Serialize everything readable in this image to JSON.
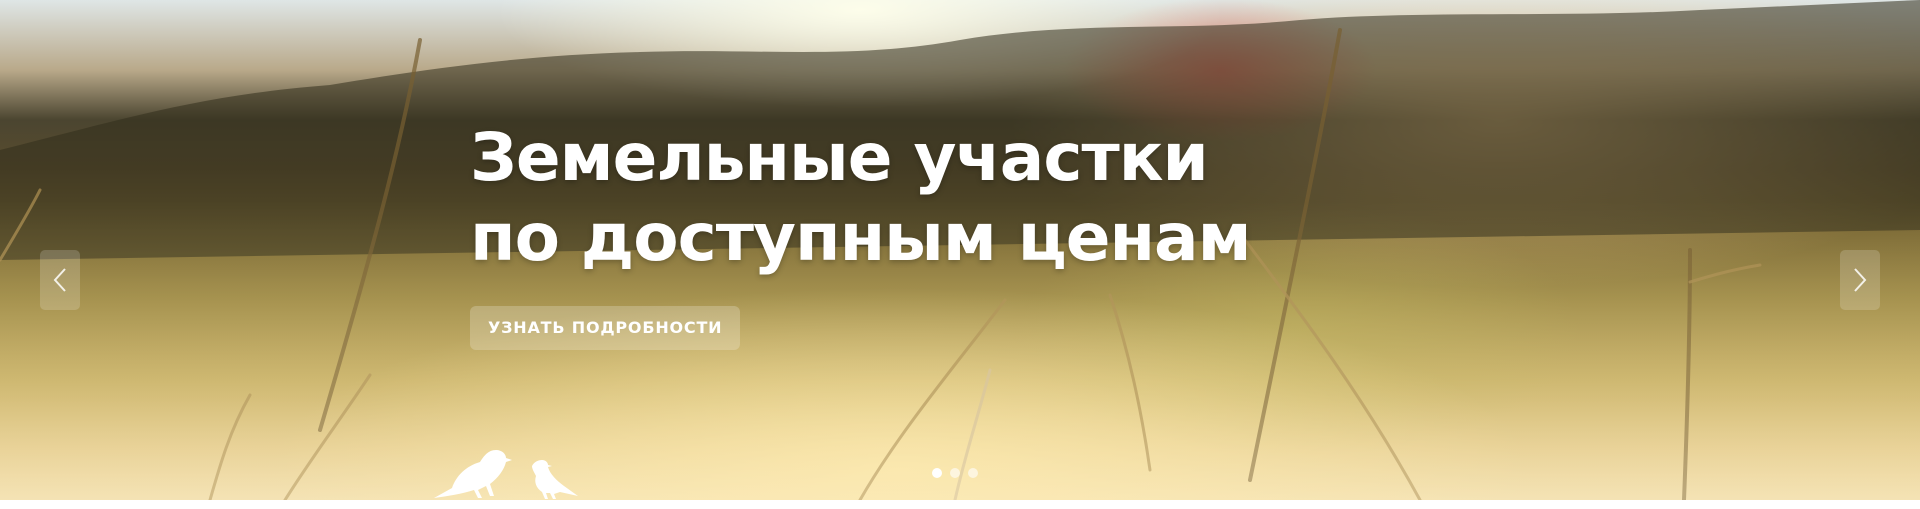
{
  "slider": {
    "headline_line1": "Земельные участки",
    "headline_line2": "по доступным ценам",
    "button_label": "УЗНАТЬ ПОДРОБНОСТИ",
    "prev_icon": "chevron-left-icon",
    "next_icon": "chevron-right-icon",
    "slides_count": 3,
    "active_slide": 1
  },
  "colors": {
    "text": "#ffffff",
    "button_bg": "rgba(255,255,255,0.22)"
  }
}
